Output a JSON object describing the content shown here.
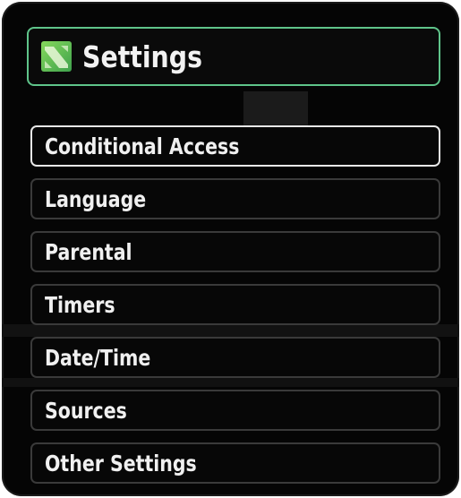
{
  "header": {
    "title": "Settings",
    "icon": "settings-screen-icon",
    "accent_color": "#5fc48a"
  },
  "menu": {
    "selected_index": 0,
    "items": [
      {
        "label": "Conditional Access"
      },
      {
        "label": "Language"
      },
      {
        "label": "Parental"
      },
      {
        "label": "Timers"
      },
      {
        "label": "Date/Time"
      },
      {
        "label": "Sources"
      },
      {
        "label": "Other Settings"
      }
    ]
  }
}
